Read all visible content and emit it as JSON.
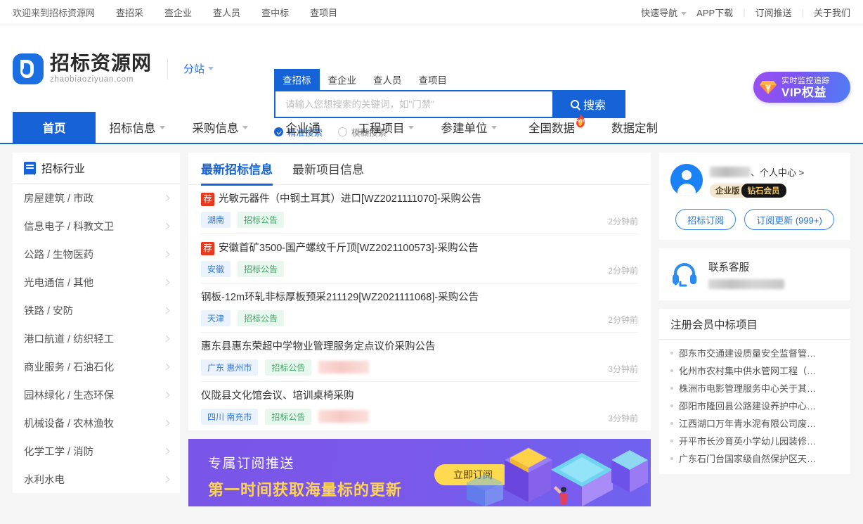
{
  "topbar": {
    "welcome": "欢迎来到招标资源网",
    "left_links": [
      "查招采",
      "查企业",
      "查人员",
      "查中标",
      "查项目"
    ],
    "quick_nav": "快速导航",
    "right_links": [
      "APP下载",
      "订阅推送",
      "关于我们"
    ]
  },
  "header": {
    "logo_title": "招标资源网",
    "logo_sub": "zhaobiaoziyuan.com",
    "subsite": "分站",
    "vip": {
      "line1": "实时监控追踪",
      "line2": "VIP权益"
    }
  },
  "search": {
    "tabs": [
      "查招标",
      "查企业",
      "查人员",
      "查项目"
    ],
    "active_tab": "查招标",
    "placeholder": "请输入您想搜索的关键词，如\"门禁\"",
    "value": "",
    "button": "搜索",
    "modes": [
      "精准搜索",
      "模糊搜索"
    ],
    "selected_mode": "精准搜索"
  },
  "mainnav": {
    "items": [
      {
        "label": "首页",
        "dropdown": false,
        "active": true,
        "hot": false
      },
      {
        "label": "招标信息",
        "dropdown": true,
        "active": false,
        "hot": false
      },
      {
        "label": "采购信息",
        "dropdown": true,
        "active": false,
        "hot": false
      },
      {
        "label": "企业通",
        "dropdown": false,
        "active": false,
        "hot": false
      },
      {
        "label": "工程项目",
        "dropdown": true,
        "active": false,
        "hot": false
      },
      {
        "label": "参建单位",
        "dropdown": true,
        "active": false,
        "hot": false
      },
      {
        "label": "全国数据",
        "dropdown": false,
        "active": false,
        "hot": true
      },
      {
        "label": "数据定制",
        "dropdown": false,
        "active": false,
        "hot": false
      }
    ],
    "hot_label": "HOT"
  },
  "sidebar": {
    "title": "招标行业",
    "items": [
      "房屋建筑 / 市政",
      "信息电子 / 科教文卫",
      "公路 / 生物医药",
      "光电通信 / 其他",
      "铁路 / 安防",
      "港口航道 / 纺织轻工",
      "商业服务 / 石油石化",
      "园林绿化 / 生态环保",
      "机械设备 / 农林渔牧",
      "化学工学 / 消防",
      "水利水电"
    ]
  },
  "news": {
    "tabs": [
      "最新招标信息",
      "最新项目信息"
    ],
    "active_tab": "最新招标信息",
    "items": [
      {
        "recommended": true,
        "rec_label": "荐",
        "title": "光敏元器件（中钢土耳其）进口[WZ2021111070]-采购公告",
        "region": "湖南",
        "type": "招标公告",
        "redacted": false,
        "time": "2分钟前"
      },
      {
        "recommended": true,
        "rec_label": "荐",
        "title": "安徽首矿3500-国产螺纹千斤顶[WZ2021100573]-采购公告",
        "region": "安徽",
        "type": "招标公告",
        "redacted": false,
        "time": "2分钟前"
      },
      {
        "recommended": false,
        "rec_label": "",
        "title": "钢板-12m环轧非标厚板预采211129[WZ2021111068]-采购公告",
        "region": "天津",
        "type": "招标公告",
        "redacted": false,
        "time": "2分钟前"
      },
      {
        "recommended": false,
        "rec_label": "",
        "title": "惠东县惠东荣超中学物业管理服务定点议价采购公告",
        "region": "广东 惠州市",
        "type": "招标公告",
        "redacted": true,
        "time": "3分钟前"
      },
      {
        "recommended": false,
        "rec_label": "",
        "title": "仪陇县文化馆会议、培训桌椅采购",
        "region": "四川 南充市",
        "type": "招标公告",
        "redacted": true,
        "time": "3分钟前"
      }
    ]
  },
  "banner": {
    "line1": "专属订阅推送",
    "line2": "第一时间获取海量标的更新",
    "button": "立即订阅"
  },
  "user": {
    "name_redacted": true,
    "center_link": "、个人中心 >",
    "badge_enterprise": "企业版",
    "badge_vip": "钻石会员",
    "buttons": [
      "招标订阅",
      "订阅更新 (999+)"
    ]
  },
  "support": {
    "title": "联系客服",
    "phone_redacted": true
  },
  "winning": {
    "title": "注册会员中标项目",
    "items": [
      "邵东市交通建设质量安全监督管…",
      "化州市农村集中供水管网工程（…",
      "株洲市电影管理服务中心关于其…",
      "邵阳市隆回县公路建设养护中心…",
      "江西湖口万年青水泥有限公司废…",
      "开平市长沙育英小学幼儿园装修…",
      "广东石门台国家级自然保护区天…"
    ]
  },
  "colors": {
    "brand_blue": "#1563d6",
    "accent_red": "#e9391d",
    "tag_green": "#3ba865",
    "banner_purple": "#7a56e8",
    "banner_yellow": "#ffd452"
  }
}
